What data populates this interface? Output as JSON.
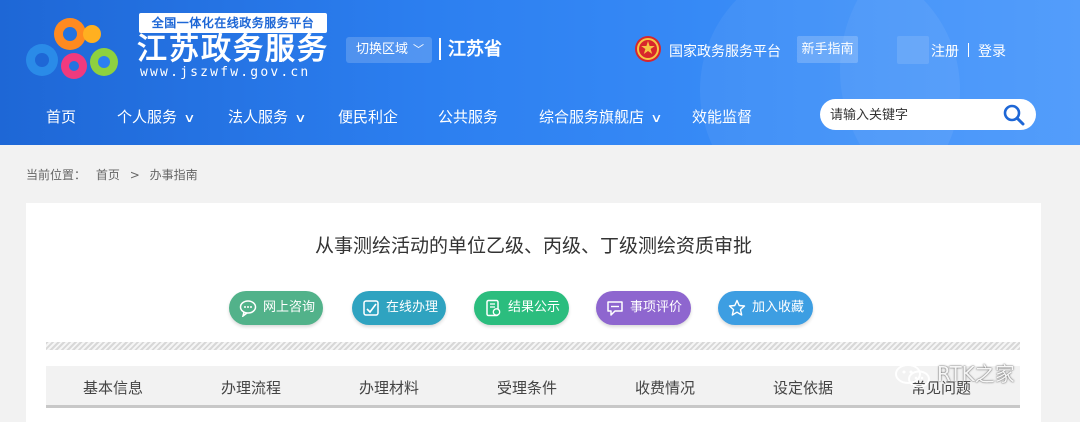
{
  "header": {
    "slogan": "全国一体化在线政务服务平台",
    "site_name": "江苏政务服务",
    "site_url": "www.jszwfw.gov.cn",
    "region_switch_label": "切换区域",
    "region_name": "江苏省",
    "gov_platform_label": "国家政务服务平台",
    "guide_label": "新手指南",
    "register_label": "注册",
    "login_label": "登录"
  },
  "nav": {
    "items": [
      {
        "label": "首页",
        "dropdown": false
      },
      {
        "label": "个人服务",
        "dropdown": true
      },
      {
        "label": "法人服务",
        "dropdown": true
      },
      {
        "label": "便民利企",
        "dropdown": false
      },
      {
        "label": "公共服务",
        "dropdown": false
      },
      {
        "label": "综合服务旗舰店",
        "dropdown": true
      },
      {
        "label": "效能监督",
        "dropdown": false
      }
    ],
    "search_placeholder": "请输入关键字"
  },
  "breadcrumb": {
    "prefix": "当前位置：",
    "home": "首页",
    "separator": ">",
    "current": "办事指南"
  },
  "item": {
    "title": "从事测绘活动的单位乙级、丙级、丁级测绘资质审批"
  },
  "actions": [
    {
      "label": "网上咨询",
      "icon": "chat-icon",
      "color": "#52b28a"
    },
    {
      "label": "在线办理",
      "icon": "edit-icon",
      "color": "#2fa3c0"
    },
    {
      "label": "结果公示",
      "icon": "document-check-icon",
      "color": "#2bbd7e"
    },
    {
      "label": "事项评价",
      "icon": "comment-icon",
      "color": "#8e66cf"
    },
    {
      "label": "加入收藏",
      "icon": "star-icon",
      "color": "#3d9ee2"
    }
  ],
  "tabs": [
    "基本信息",
    "办理流程",
    "办理材料",
    "受理条件",
    "收费情况",
    "设定依据",
    "常见问题"
  ],
  "watermark": "RTK之家",
  "colors": {
    "header_blue": "#1e67d6",
    "page_bg": "#f2f2f2"
  }
}
